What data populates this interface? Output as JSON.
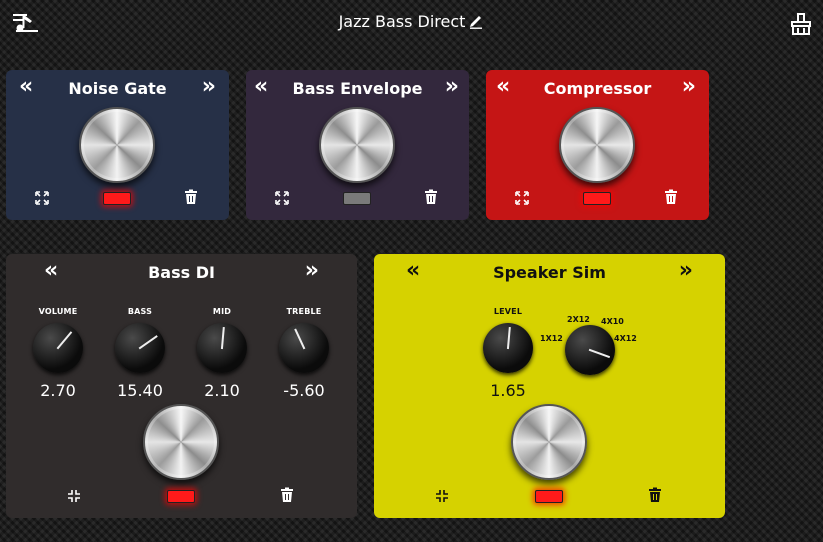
{
  "header": {
    "title": "Jazz Bass Direct",
    "left_icon": "presets-icon",
    "edit_icon": "pencil-icon",
    "right_icon": "settings-icon"
  },
  "colors": {
    "noise_gate": "#263047",
    "bass_envelope": "#33283d",
    "compressor": "#c51515",
    "bass_di": "#302c2c",
    "speaker_sim": "#d6d200",
    "led_on": "#ff1a1a",
    "led_off": "#7a7a7a"
  },
  "panels": {
    "noise_gate": {
      "title": "Noise Gate",
      "prev": "«",
      "next": "»",
      "enabled": true
    },
    "bass_envelope": {
      "title": "Bass Envelope",
      "prev": "«",
      "next": "»",
      "enabled": false
    },
    "compressor": {
      "title": "Compressor",
      "prev": "«",
      "next": "»",
      "enabled": true
    },
    "bass_di": {
      "title": "Bass DI",
      "prev": "«",
      "next": "»",
      "enabled": true,
      "controls": [
        {
          "label": "VOLUME",
          "value": "2.70"
        },
        {
          "label": "BASS",
          "value": "15.40"
        },
        {
          "label": "MID",
          "value": "2.10"
        },
        {
          "label": "TREBLE",
          "value": "-5.60"
        }
      ]
    },
    "speaker_sim": {
      "title": "Speaker Sim",
      "prev": "«",
      "next": "»",
      "enabled": true,
      "level": {
        "label": "LEVEL",
        "value": "1.65"
      },
      "cabinet": {
        "options": [
          "1X12",
          "2X12",
          "4X10",
          "4X12"
        ],
        "selected": "4X12"
      }
    }
  }
}
